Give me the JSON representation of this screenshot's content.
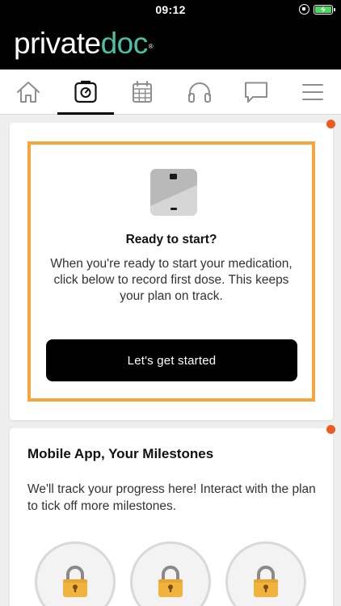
{
  "status_bar": {
    "time": "09:12"
  },
  "header": {
    "logo_part1": "private",
    "logo_part2": "doc",
    "logo_mark": "®"
  },
  "nav": {
    "tabs": [
      {
        "icon": "home-icon",
        "active": false
      },
      {
        "icon": "scale-icon",
        "active": true
      },
      {
        "icon": "calendar-icon",
        "active": false
      },
      {
        "icon": "headphones-icon",
        "active": false
      },
      {
        "icon": "chat-icon",
        "active": false
      },
      {
        "icon": "menu-icon",
        "active": false
      }
    ]
  },
  "ready_card": {
    "title": "Ready to start?",
    "description": "When you're ready to start your medication, click below to record first dose. This keeps your plan on track.",
    "button_label": "Let's get started"
  },
  "milestones_card": {
    "title": "Mobile App, Your Milestones",
    "description": "We'll track your progress here! Interact with the plan to tick off more milestones.",
    "badges": [
      {
        "icon": "padlock-icon"
      },
      {
        "icon": "padlock-icon"
      },
      {
        "icon": "padlock-icon"
      }
    ]
  },
  "colors": {
    "accent_teal": "#4cc0a4",
    "highlight_orange": "#f5a63a",
    "notification_dot": "#f05a22",
    "padlock_gold": "#f2b33d"
  }
}
